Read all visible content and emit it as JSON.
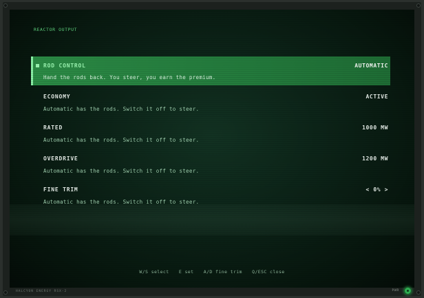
{
  "screen": {
    "title": "REACTOR OUTPUT"
  },
  "menu": {
    "items": [
      {
        "label": "ROD CONTROL",
        "value": "AUTOMATIC",
        "description": "Hand the rods back. You steer, you earn the premium.",
        "selected": true
      },
      {
        "label": "ECONOMY",
        "value": "ACTIVE",
        "description": "Automatic has the rods. Switch it off to steer.",
        "selected": false
      },
      {
        "label": "RATED",
        "value": "1000 MW",
        "description": "Automatic has the rods. Switch it off to steer.",
        "selected": false
      },
      {
        "label": "OVERDRIVE",
        "value": "1200 MW",
        "description": "Automatic has the rods. Switch it off to steer.",
        "selected": false
      },
      {
        "label": "FINE TRIM",
        "value": "< 0% >",
        "description": "Automatic has the rods. Switch it off to steer.",
        "selected": false
      }
    ]
  },
  "hints": [
    "W/S select",
    "E set",
    "A/D fine trim",
    "Q/ESC close"
  ],
  "footer": {
    "brand": "HALCYON ENERGY   RSX-2",
    "power_label": "PWR",
    "power_icon": "power-button-icon"
  },
  "colors": {
    "accent": "#2b8a45",
    "accent_text": "#9af5b0",
    "title": "#5fd27e",
    "power_led": "#2fae52"
  }
}
